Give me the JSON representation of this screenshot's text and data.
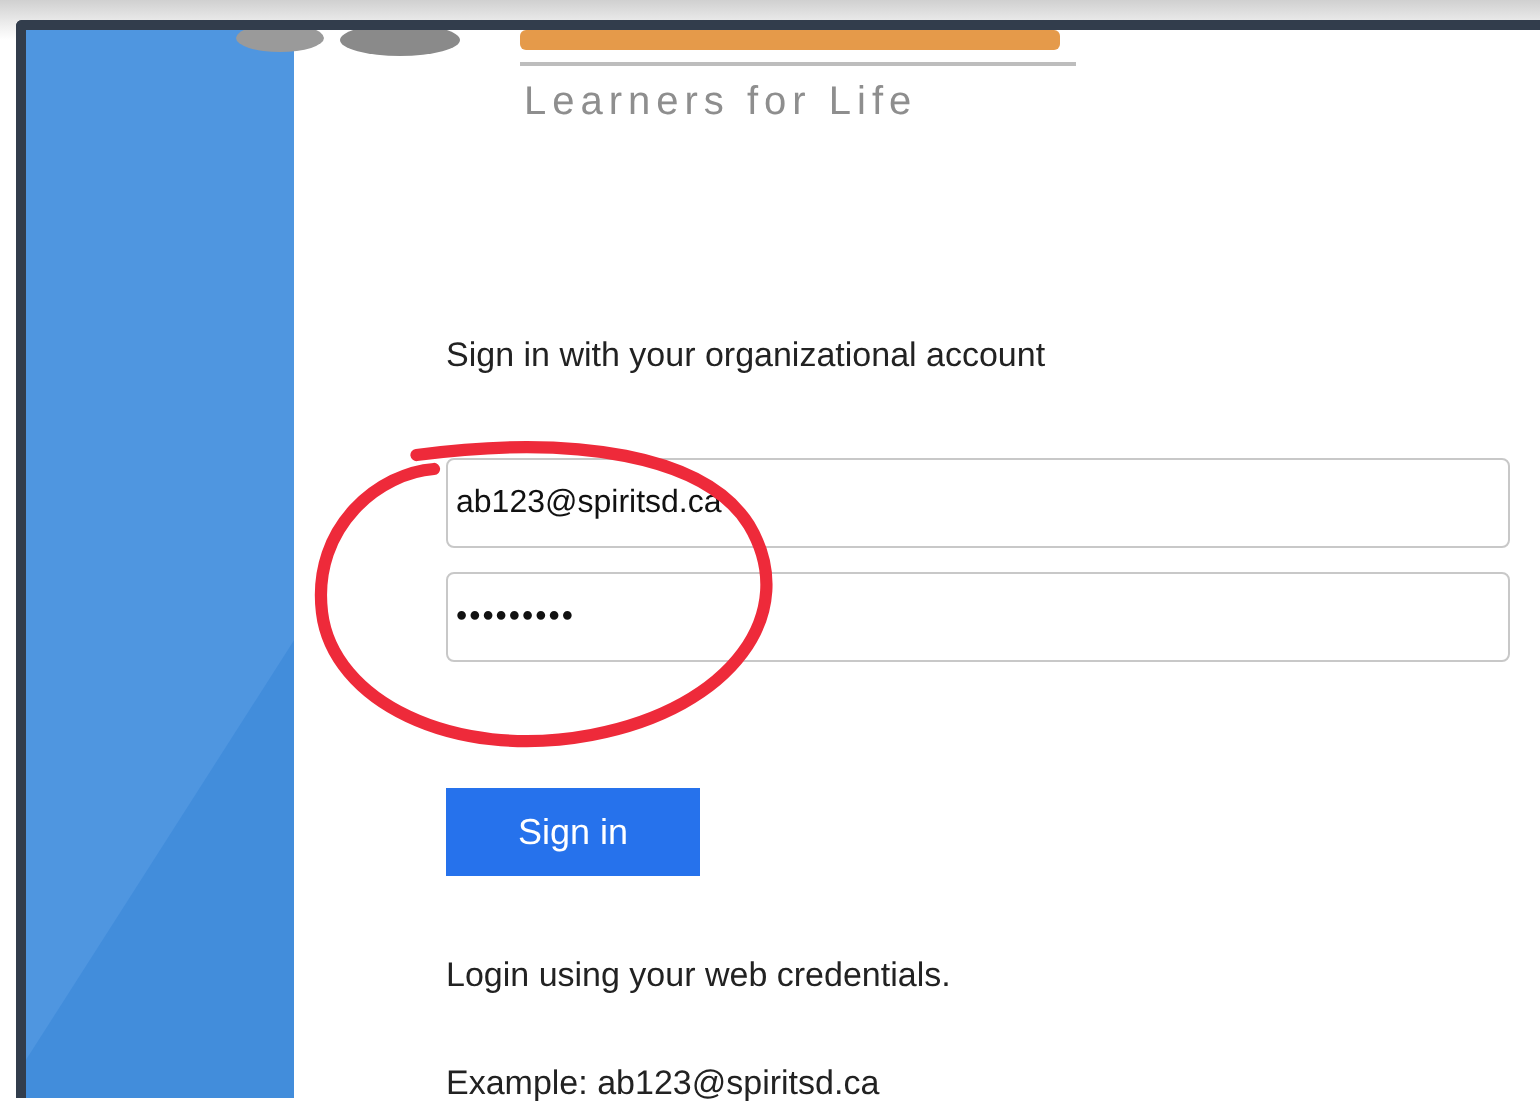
{
  "logo": {
    "tagline": "Learners for Life"
  },
  "sign_in": {
    "heading": "Sign in with your organizational account",
    "fields": [
      {
        "kind": "text",
        "value": "ab123@spiritsd.ca"
      },
      {
        "kind": "password",
        "value": "•••••••••"
      }
    ],
    "button": "Sign in",
    "help": [
      "Login using your web credentials.",
      "Example: ab123@spiritsd.ca"
    ]
  }
}
